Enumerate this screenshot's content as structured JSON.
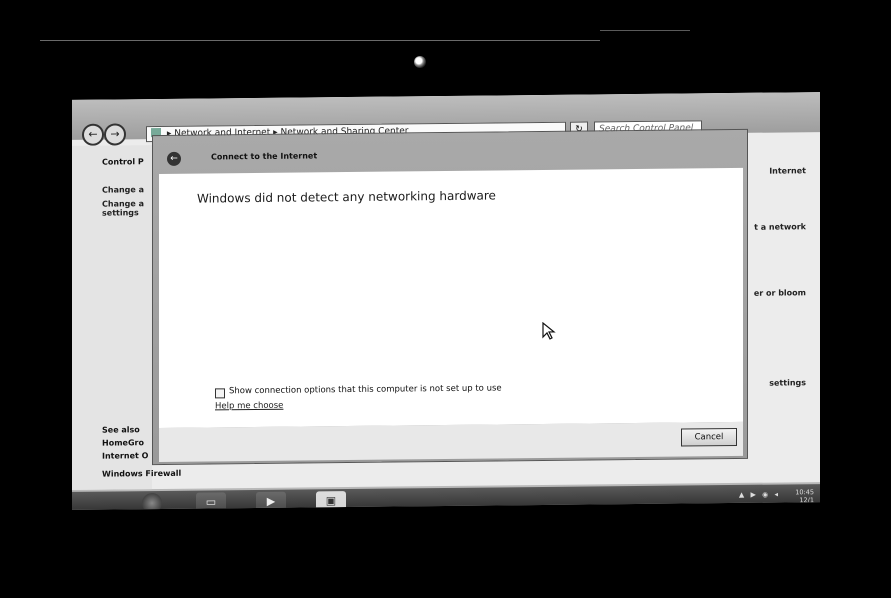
{
  "explorer": {
    "address_parts": [
      "Network and Internet",
      "Network and Sharing Center"
    ],
    "address_sep": "▸",
    "search_placeholder": "Search Control Panel",
    "left_pane": {
      "title": "Control P",
      "link1": "Change a",
      "link2a": "Change a",
      "link2b": "settings"
    },
    "right_column": [
      "Internet",
      "t a network",
      "er or bloom",
      "settings"
    ],
    "see_also": {
      "heading": "See also",
      "items": [
        "HomeGro",
        "Internet O",
        "Windows Firewall"
      ]
    }
  },
  "dialog": {
    "title": "Connect to the Internet",
    "heading": "Windows did not detect any networking hardware",
    "checkbox_label": "Show connection options that this computer is not set up to use",
    "help_link": "Help me choose",
    "cancel_label": "Cancel"
  },
  "taskbar": {
    "items": [
      {
        "icon": "folder-icon"
      },
      {
        "icon": "media-player-icon"
      },
      {
        "icon": "network-icon"
      }
    ],
    "tray_text": "▲ ▶ ◉ ◂",
    "clock_time": "10:45",
    "clock_date": "12/1"
  },
  "icons": {
    "nav_back": "←",
    "nav_forward": "→",
    "refresh": "↻",
    "dialog_back": "←",
    "media_play": "▶"
  }
}
